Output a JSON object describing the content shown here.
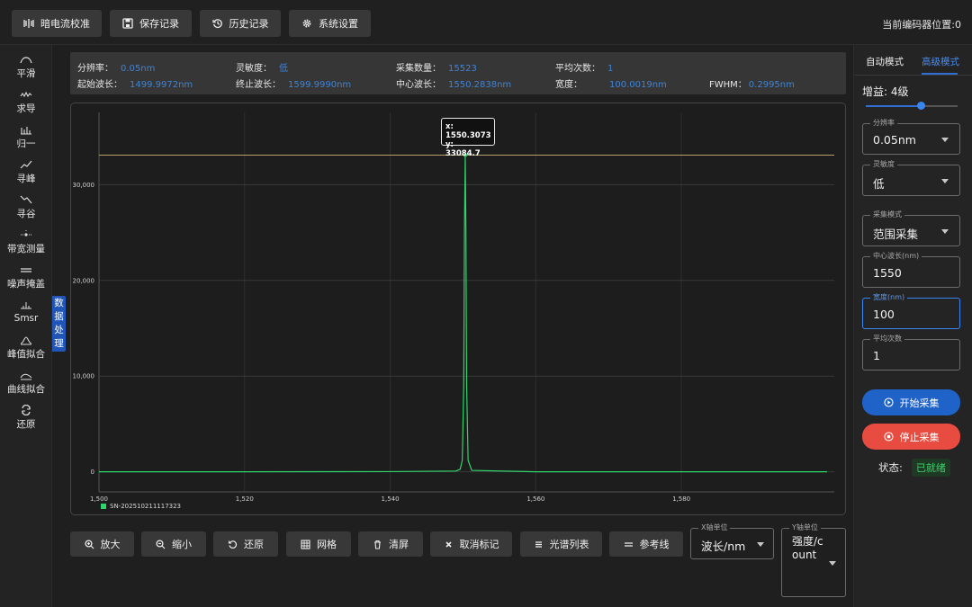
{
  "toolbar": {
    "buttons": [
      {
        "label": "暗电流校准",
        "icon": "calibrate-icon"
      },
      {
        "label": "保存记录",
        "icon": "save-icon"
      },
      {
        "label": "历史记录",
        "icon": "history-icon"
      },
      {
        "label": "系统设置",
        "icon": "gear-icon"
      }
    ],
    "encoder_label": "当前编码器位置:0"
  },
  "sidebar": {
    "items": [
      {
        "label": "平滑",
        "icon": "smooth-icon"
      },
      {
        "label": "求导",
        "icon": "derivative-icon"
      },
      {
        "label": "归一",
        "icon": "normalize-icon"
      },
      {
        "label": "寻峰",
        "icon": "peak-icon"
      },
      {
        "label": "寻谷",
        "icon": "valley-icon"
      },
      {
        "label": "带宽测量",
        "icon": "bandwidth-icon"
      },
      {
        "label": "噪声掩盖",
        "icon": "noise-mask-icon"
      },
      {
        "label": "Smsr",
        "icon": "smsr-icon"
      },
      {
        "label": "峰值拟合",
        "icon": "peak-fit-icon"
      },
      {
        "label": "曲线拟合",
        "icon": "curve-fit-icon"
      },
      {
        "label": "还原",
        "icon": "restore-icon"
      }
    ],
    "data_tab_label": "数据处理"
  },
  "info": {
    "resolution": {
      "label": "分辨率：",
      "value": "0.05nm"
    },
    "sensitivity": {
      "label": "灵敏度：",
      "value": "低"
    },
    "sample_count": {
      "label": "采集数量：",
      "value": "15523"
    },
    "average": {
      "label": "平均次数：",
      "value": "1"
    },
    "start_wl": {
      "label": "起始波长：",
      "value": "1499.9972nm"
    },
    "end_wl": {
      "label": "终止波长：",
      "value": "1599.9990nm"
    },
    "center_wl": {
      "label": "中心波长：",
      "value": "1550.2838nm"
    },
    "width": {
      "label": "宽度：",
      "value": "100.0019nm"
    },
    "fwhm": {
      "label": "FWHM：",
      "value": "0.2995nm"
    }
  },
  "chart_data": {
    "type": "line",
    "x_ticks": [
      1500,
      1520,
      1540,
      1560,
      1580
    ],
    "x_tick_labels": [
      "1,500",
      "1,520",
      "1,540",
      "1,560",
      "1,580"
    ],
    "y_ticks": [
      0,
      10000,
      20000,
      30000
    ],
    "y_tick_labels": [
      "0",
      "10,000",
      "20,000",
      "30,000"
    ],
    "xlim": [
      1500,
      1601
    ],
    "ylim": [
      -2100,
      36800
    ],
    "grid": true,
    "series": [
      {
        "name": "SN-202510211117323",
        "color": "#2fd46a",
        "x": [
          1500,
          1520,
          1540,
          1549.0,
          1549.6,
          1549.9,
          1550.1,
          1550.2,
          1550.3073,
          1550.4,
          1550.5,
          1550.7,
          1551.2,
          1560,
          1580,
          1600
        ],
        "y": [
          0,
          0,
          20,
          80,
          250,
          1200,
          9000,
          25000,
          33084.7,
          25000,
          9000,
          1200,
          150,
          0,
          0,
          0
        ]
      }
    ],
    "marker_line_y": 33084.7,
    "marker_line_color": "#b8a06a",
    "tooltip": {
      "x_text": "x: 1550.3073",
      "y_text": "y: 33084.7",
      "x": 1550.3073,
      "y": 33084.7
    },
    "legend_position": "bottom-left"
  },
  "bottom": {
    "buttons": [
      {
        "label": "放大",
        "icon": "zoom-in-icon"
      },
      {
        "label": "缩小",
        "icon": "zoom-out-icon"
      },
      {
        "label": "还原",
        "icon": "reset-zoom-icon"
      },
      {
        "label": "网格",
        "icon": "grid-icon"
      },
      {
        "label": "清屏",
        "icon": "clear-icon"
      },
      {
        "label": "取消标记",
        "icon": "cancel-mark-icon"
      },
      {
        "label": "光谱列表",
        "icon": "list-icon"
      },
      {
        "label": "参考线",
        "icon": "reference-line-icon"
      }
    ],
    "x_unit": {
      "label": "X轴单位",
      "value": "波长/nm"
    },
    "y_unit": {
      "label": "Y轴单位",
      "value": "强度/count"
    }
  },
  "right": {
    "tabs": [
      "自动模式",
      "高级模式"
    ],
    "active_tab": 1,
    "gain_label": "增益: 4级",
    "gain_level": 0.6,
    "resolution": {
      "label": "分辨率",
      "value": "0.05nm"
    },
    "sensitivity": {
      "label": "灵敏度",
      "value": "低"
    },
    "mode": {
      "label": "采集模式",
      "value": "范围采集"
    },
    "center": {
      "label": "中心波长(nm)",
      "value": "1550"
    },
    "width": {
      "label": "宽度(nm)",
      "value": "100"
    },
    "average": {
      "label": "平均次数",
      "value": "1"
    },
    "start_label": "开始采集",
    "stop_label": "停止采集",
    "status_label": "状态:",
    "status_value": "已就绪",
    "colors": {
      "accent": "#2e6fd1",
      "start": "#1f63c9",
      "stop": "#e84b3f",
      "ready": "#3fcf6a"
    }
  }
}
